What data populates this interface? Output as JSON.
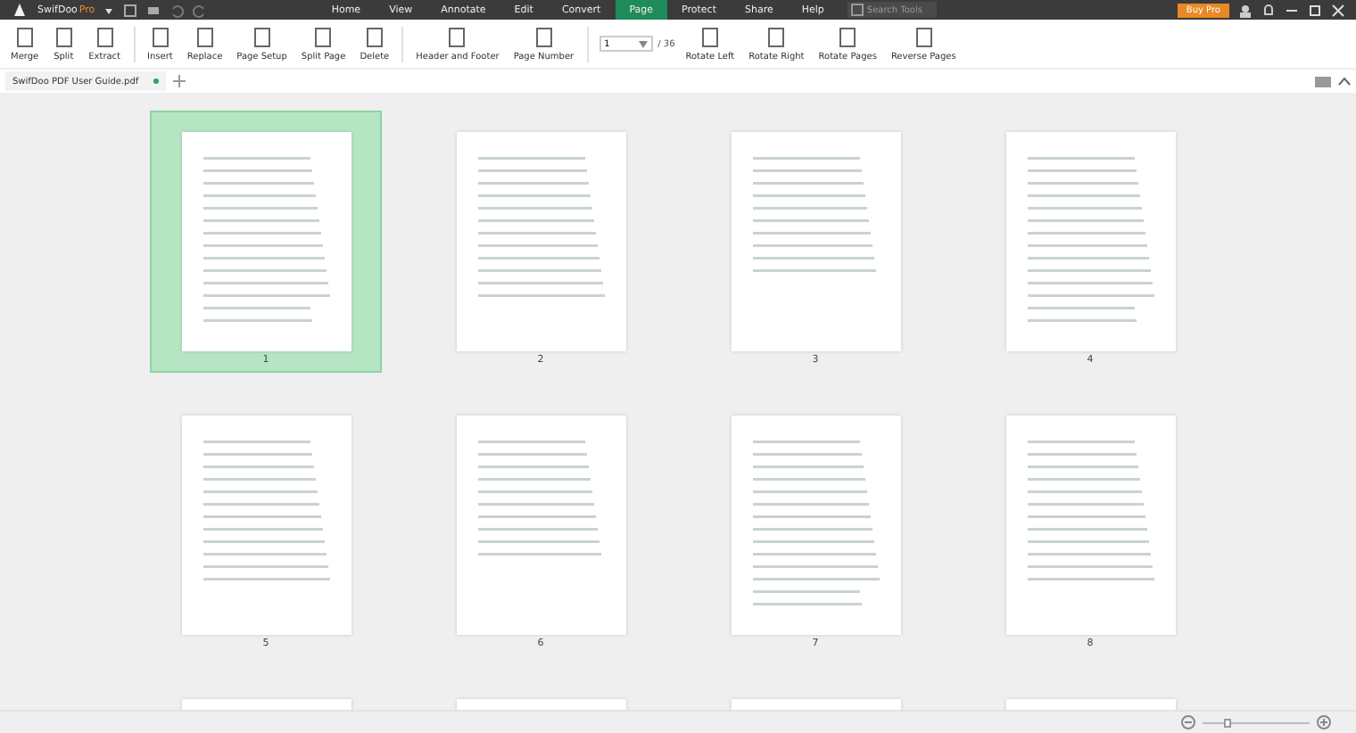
{
  "title_bar": {
    "app_name": "SwifDoo",
    "edition": "Pro",
    "menu": [
      {
        "label": "Home",
        "selected": false
      },
      {
        "label": "View",
        "selected": false
      },
      {
        "label": "Annotate",
        "selected": false
      },
      {
        "label": "Edit",
        "selected": false
      },
      {
        "label": "Convert",
        "selected": false
      },
      {
        "label": "Page",
        "selected": true
      },
      {
        "label": "Protect",
        "selected": false
      },
      {
        "label": "Share",
        "selected": false
      },
      {
        "label": "Help",
        "selected": false
      }
    ],
    "search": {
      "placeholder": "Search Tools"
    },
    "buy_button": "Buy Pro"
  },
  "toolbar": {
    "groups": [
      [
        "Merge",
        "Split",
        "Extract"
      ],
      [
        "Insert",
        "Replace",
        "Page Setup",
        "Split Page",
        "Delete"
      ],
      [
        "Header and Footer",
        "Page Number"
      ]
    ],
    "page_input": {
      "value": "1",
      "total": "/ 36"
    },
    "after": [
      "Rotate Left",
      "Rotate Right",
      "Rotate Pages",
      "Reverse Pages"
    ]
  },
  "document_tab": {
    "label": "SwifDoo PDF User Guide.pdf",
    "modified": true
  },
  "pages": [
    {
      "number": "1",
      "selected": true
    },
    {
      "number": "2",
      "selected": false
    },
    {
      "number": "3",
      "selected": false
    },
    {
      "number": "4",
      "selected": false
    },
    {
      "number": "5",
      "selected": false
    },
    {
      "number": "6",
      "selected": false
    },
    {
      "number": "7",
      "selected": false
    },
    {
      "number": "8",
      "selected": false
    }
  ],
  "zoom": {
    "level": 0.2
  }
}
